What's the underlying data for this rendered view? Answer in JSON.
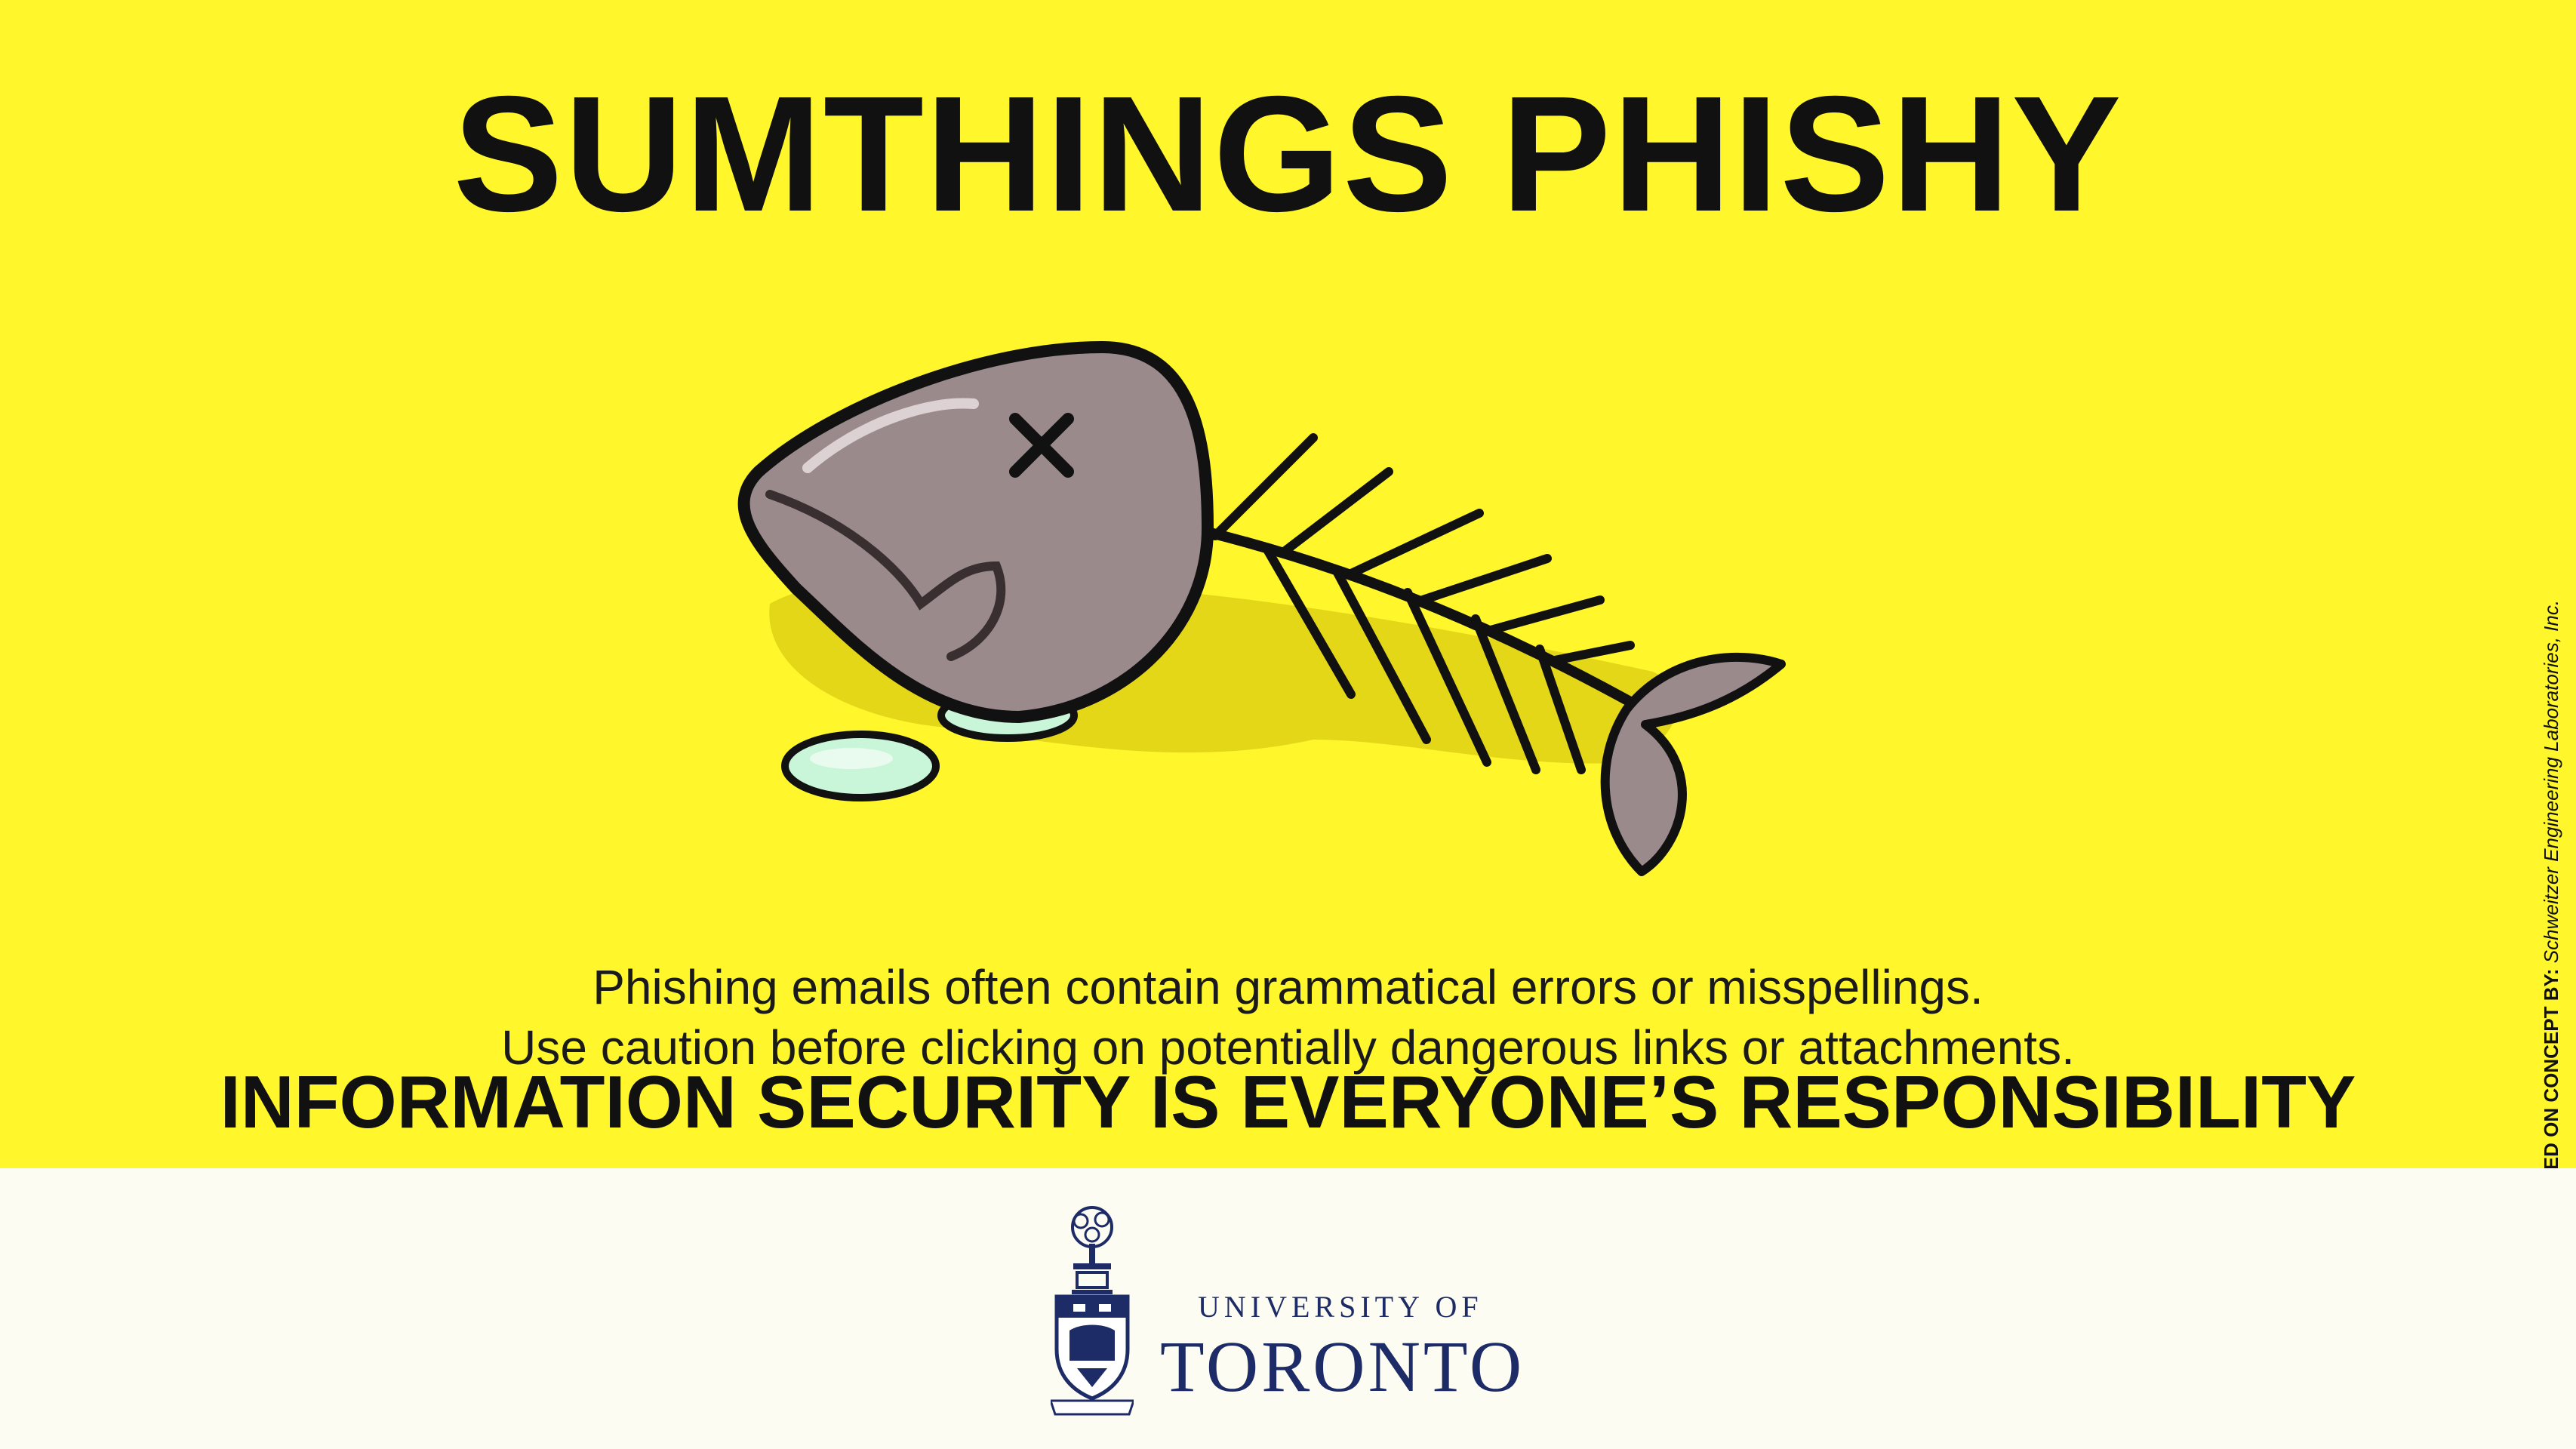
{
  "poster": {
    "headline": "SUMTHINGS PHISHY",
    "body_line_1": "Phishing emails often contain grammatical errors or misspellings.",
    "body_line_2": "Use caution before clicking on potentially dangerous links or attachments.",
    "tagline": "INFORMATION SECURITY IS EVERYONE’S RESPONSIBILITY"
  },
  "credit": {
    "label": "BASED ON CONCEPT BY:",
    "source": "Schweitzer Engineering Laboratories, Inc."
  },
  "footer": {
    "university_line_1": "UNIVERSITY OF",
    "university_line_2": "TORONTO",
    "crest_icon": "university-crest-icon"
  },
  "colors": {
    "background_yellow": "#fff62b",
    "footer_bg": "#fdfcf3",
    "text_dark": "#111111",
    "uoft_navy": "#1d2b66",
    "fish_gray": "#9a8a8c",
    "tear_mint": "#c9f5d8"
  },
  "illustration": {
    "icon": "dead-fish-skeleton-icon"
  }
}
